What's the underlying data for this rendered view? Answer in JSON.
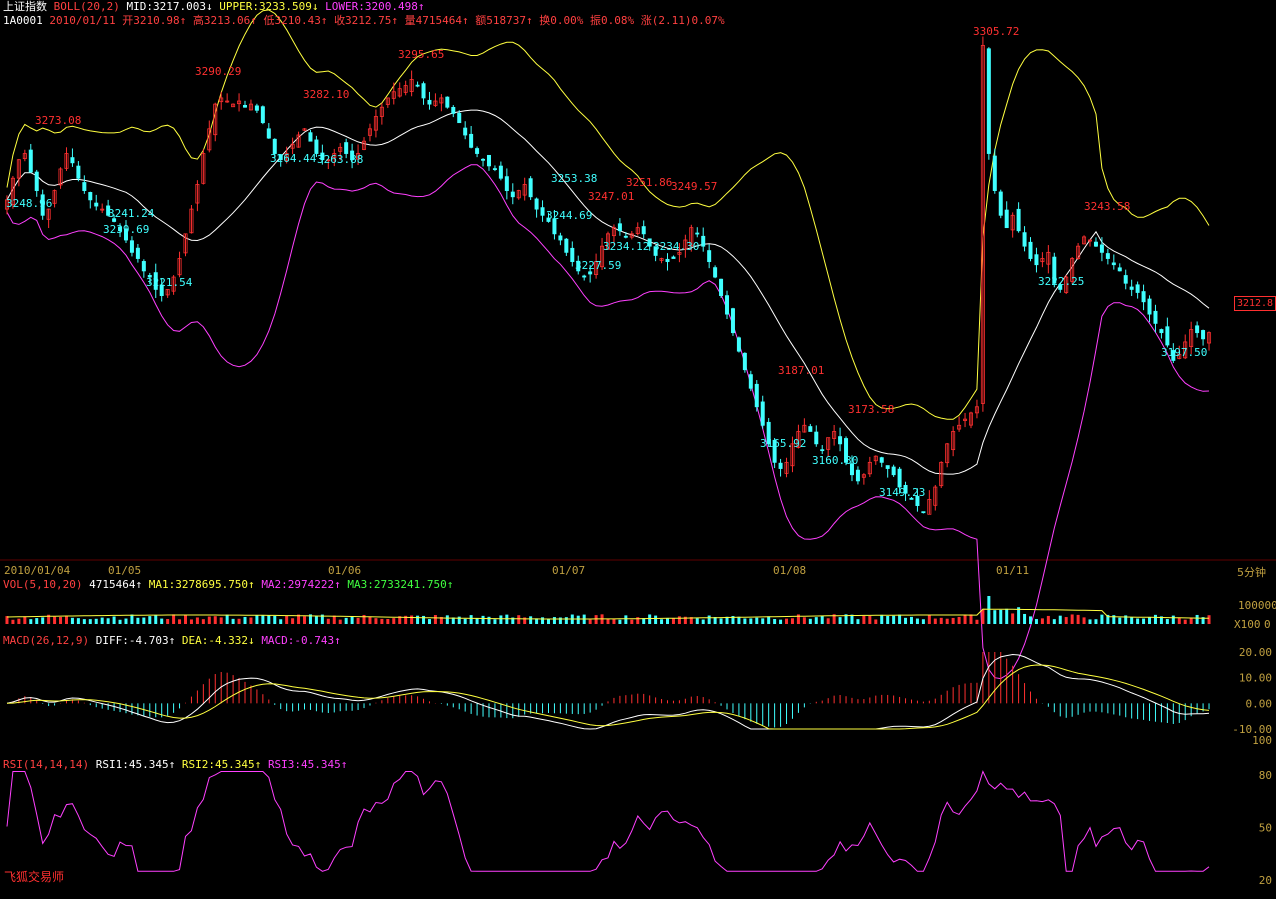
{
  "header": {
    "index_name": "上证指数",
    "boll_label": "BOLL(20,2)",
    "mid": "MID:3217.003↓",
    "upper": "UPPER:3233.509↓",
    "lower": "LOWER:3200.498↑",
    "code": "1A0001",
    "date": "2010/01/11",
    "open": "开3210.98↑",
    "high": "高3213.06↑",
    "low": "低3210.43↑",
    "close": "收3212.75↑",
    "volume": "量4715464↑",
    "amount": "额518737↑",
    "turnover": "换0.00%",
    "amplitude": "振0.08%",
    "change": "涨(2.11)0.07%"
  },
  "vol_header": {
    "label": "VOL(5,10,20)",
    "value": "4715464↑",
    "ma1": "MA1:3278695.750↑",
    "ma2": "MA2:2974222↑",
    "ma3": "MA3:2733241.750↑"
  },
  "macd_header": {
    "label": "MACD(26,12,9)",
    "diff": "DIFF:-4.703↑",
    "dea": "DEA:-4.332↓",
    "macd": "MACD:-0.743↑"
  },
  "rsi_header": {
    "label": "RSI(14,14,14)",
    "rsi1": "RSI1:45.345↑",
    "rsi2": "RSI2:45.345↑",
    "rsi3": "RSI3:45.345↑"
  },
  "date_labels": [
    "2010/01/04",
    "01/05",
    "01/06",
    "01/07",
    "01/08",
    "01/11"
  ],
  "period": "5分钟",
  "brand": "飞狐交易师",
  "last_price": "3212.8",
  "colors": {
    "up": "#ff3030",
    "down": "#40ffff",
    "mid": "#ffffff",
    "upper": "#ffff40",
    "lower": "#ff40ff",
    "rsi": "#ff40ff",
    "macd_pos": "#ff3030",
    "macd_neg": "#40ffff"
  },
  "chart_data": [
    {
      "type": "candlestick",
      "title": "上证指数 BOLL(20,2)",
      "ylim": [
        3140,
        3310
      ],
      "high_labels": [
        "3273.08",
        "3290.29",
        "3282.10",
        "3295.65",
        "3247.01",
        "3251.86",
        "3249.57",
        "3187.01",
        "3173.58",
        "3305.72",
        "3243.58"
      ],
      "low_labels": [
        "3248.96",
        "3241.24",
        "3239.69",
        "3221.54",
        "3264.44",
        "3263.88",
        "3253.38",
        "3244.69",
        "3234.12",
        "3227.59",
        "3234.30",
        "3165.92",
        "3160.30",
        "3149.23",
        "3222.25",
        "3197.50"
      ],
      "series_close": [
        3255,
        3262,
        3268,
        3270,
        3264,
        3258,
        3250,
        3252,
        3258,
        3265,
        3270,
        3267,
        3262,
        3258,
        3255,
        3253,
        3252,
        3250,
        3248,
        3245,
        3242,
        3238,
        3236,
        3232,
        3230,
        3226,
        3224,
        3226,
        3230,
        3236,
        3244,
        3252,
        3260,
        3270,
        3278,
        3286,
        3288,
        3287,
        3286,
        3287,
        3285,
        3286,
        3284,
        3280,
        3275,
        3270,
        3268,
        3270,
        3273,
        3276,
        3278,
        3274,
        3270,
        3268,
        3268,
        3270,
        3272,
        3270,
        3268,
        3270,
        3274,
        3278,
        3282,
        3285,
        3288,
        3290,
        3291,
        3292,
        3294,
        3292,
        3288,
        3286,
        3287,
        3288,
        3285,
        3283,
        3280,
        3276,
        3272,
        3270,
        3268,
        3266,
        3265,
        3262,
        3258,
        3256,
        3258,
        3260,
        3256,
        3252,
        3250,
        3248,
        3244,
        3242,
        3238,
        3235,
        3232,
        3230,
        3231,
        3235,
        3240,
        3244,
        3246,
        3245,
        3243,
        3244,
        3246,
        3244,
        3240,
        3237,
        3236,
        3235,
        3236,
        3238,
        3242,
        3246,
        3244,
        3240,
        3235,
        3230,
        3224,
        3218,
        3212,
        3206,
        3200,
        3194,
        3188,
        3182,
        3176,
        3170,
        3168,
        3170,
        3176,
        3180,
        3182,
        3180,
        3176,
        3174,
        3178,
        3180,
        3176,
        3170,
        3166,
        3164,
        3166,
        3170,
        3172,
        3170,
        3168,
        3166,
        3162,
        3160,
        3158,
        3156,
        3154,
        3158,
        3162,
        3170,
        3176,
        3180,
        3182,
        3184,
        3186,
        3188,
        3305,
        3270,
        3258,
        3250,
        3246,
        3250,
        3245,
        3240,
        3236,
        3234,
        3236,
        3238,
        3228,
        3226,
        3230,
        3236,
        3240,
        3243,
        3242,
        3240,
        3238,
        3236,
        3234,
        3232,
        3228,
        3226,
        3225,
        3222,
        3218,
        3215,
        3212,
        3208,
        3203,
        3205,
        3209,
        3213,
        3212,
        3210,
        3212
      ]
    },
    {
      "type": "bar",
      "title": "VOL(5,10,20)",
      "ylim": [
        0,
        100000
      ],
      "tick_labels": [
        "100000",
        "X100",
        "0"
      ]
    },
    {
      "type": "line",
      "title": "MACD(26,12,9)",
      "ylim": [
        -10,
        20
      ],
      "tick_labels": [
        "20.00",
        "10.00",
        "0.00",
        "-10.00"
      ]
    },
    {
      "type": "line",
      "title": "RSI(14,14,14)",
      "ylim": [
        20,
        100
      ],
      "tick_labels": [
        "100",
        "80",
        "50",
        "20"
      ]
    }
  ]
}
